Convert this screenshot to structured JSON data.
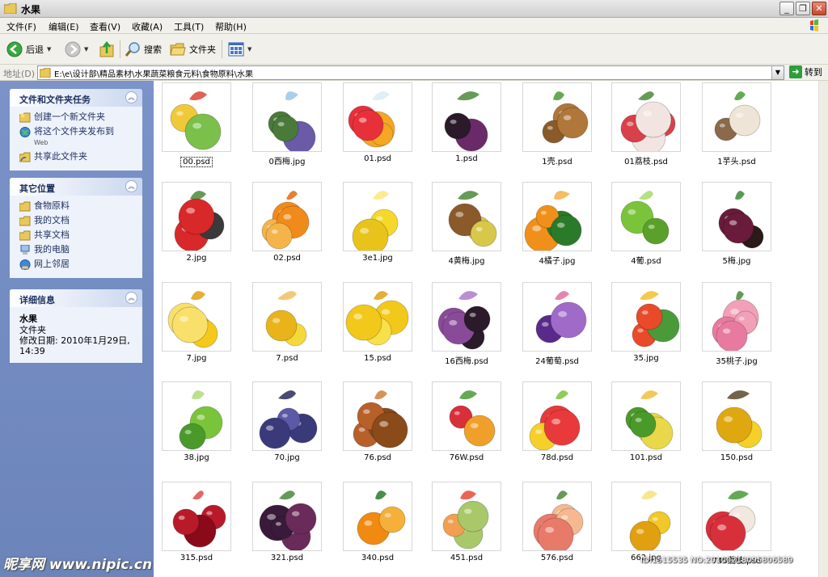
{
  "window": {
    "title": "水果"
  },
  "menu": [
    "文件(F)",
    "编辑(E)",
    "查看(V)",
    "收藏(A)",
    "工具(T)",
    "帮助(H)"
  ],
  "toolbar": {
    "back_label": "后退",
    "search_label": "搜索",
    "folders_label": "文件夹"
  },
  "address": {
    "label": "地址(D)",
    "path": "E:\\e\\设计部\\精品素材\\水果蔬菜粮食元料\\食物原料\\水果",
    "go_label": "转到"
  },
  "tasks_panel": {
    "title": "文件和文件夹任务",
    "items": [
      {
        "label": "创建一个新文件夹",
        "icon": "new-folder-icon"
      },
      {
        "label": "将这个文件夹发布到",
        "sub": "Web",
        "icon": "web-publish-icon"
      },
      {
        "label": "共享此文件夹",
        "icon": "share-folder-icon"
      }
    ]
  },
  "places_panel": {
    "title": "其它位置",
    "items": [
      {
        "label": "食物原料",
        "icon": "folder-icon"
      },
      {
        "label": "我的文档",
        "icon": "folder-icon"
      },
      {
        "label": "共享文档",
        "icon": "folder-icon"
      },
      {
        "label": "我的电脑",
        "icon": "computer-icon"
      },
      {
        "label": "网上邻居",
        "icon": "network-icon"
      }
    ]
  },
  "details_panel": {
    "title": "详细信息",
    "name": "水果",
    "type": "文件夹",
    "modified": "修改日期: 2010年1月29日,",
    "time": "14:39"
  },
  "files": [
    {
      "name": "00.psd",
      "fruit": "apple-grape"
    },
    {
      "name": "0西梅.jpg",
      "fruit": "plum-photo"
    },
    {
      "name": "01.psd",
      "fruit": "mixed-ice"
    },
    {
      "name": "1.psd",
      "fruit": "prune"
    },
    {
      "name": "1壳.psd",
      "fruit": "walnut"
    },
    {
      "name": "01荔枝.psd",
      "fruit": "lychee"
    },
    {
      "name": "1芋头.psd",
      "fruit": "taro"
    },
    {
      "name": "2.jpg",
      "fruit": "tomato-crate"
    },
    {
      "name": "02.psd",
      "fruit": "orange"
    },
    {
      "name": "3e1.jpg",
      "fruit": "lemon"
    },
    {
      "name": "4黄梅.jpg",
      "fruit": "yellow-plum"
    },
    {
      "name": "4橘子.jpg",
      "fruit": "tangerine"
    },
    {
      "name": "4葡.psd",
      "fruit": "green-grape"
    },
    {
      "name": "5梅.jpg",
      "fruit": "purple-plum"
    },
    {
      "name": "7.jpg",
      "fruit": "lemon-cut"
    },
    {
      "name": "7.psd",
      "fruit": "banana"
    },
    {
      "name": "15.psd",
      "fruit": "mango"
    },
    {
      "name": "16西梅.psd",
      "fruit": "prune-purple"
    },
    {
      "name": "24葡萄.psd",
      "fruit": "purple-grape-mix"
    },
    {
      "name": "35.jpg",
      "fruit": "mixed-bowl"
    },
    {
      "name": "35桃子.jpg",
      "fruit": "peach-pink"
    },
    {
      "name": "38.jpg",
      "fruit": "green-grape-2"
    },
    {
      "name": "70.jpg",
      "fruit": "blue-grape"
    },
    {
      "name": "76.psd",
      "fruit": "kiwi"
    },
    {
      "name": "76W.psd",
      "fruit": "mixed-berries"
    },
    {
      "name": "78d.psd",
      "fruit": "fruit-platter"
    },
    {
      "name": "101.psd",
      "fruit": "apricot"
    },
    {
      "name": "150.psd",
      "fruit": "banana-bunch"
    },
    {
      "name": "315.psd",
      "fruit": "bayberry"
    },
    {
      "name": "321.psd",
      "fruit": "dark-plum"
    },
    {
      "name": "340.psd",
      "fruit": "orange-slices"
    },
    {
      "name": "451.psd",
      "fruit": "melon"
    },
    {
      "name": "576.psd",
      "fruit": "peach"
    },
    {
      "name": "662.jpg",
      "fruit": "yellow-cherry"
    },
    {
      "name": "745荔枝.psd",
      "fruit": "lychee-2"
    }
  ],
  "selected_file": "00.psd",
  "watermark": {
    "left": "昵享网 www.nipic.cn",
    "right": "ID:1515535 NO:20100218095806589"
  }
}
